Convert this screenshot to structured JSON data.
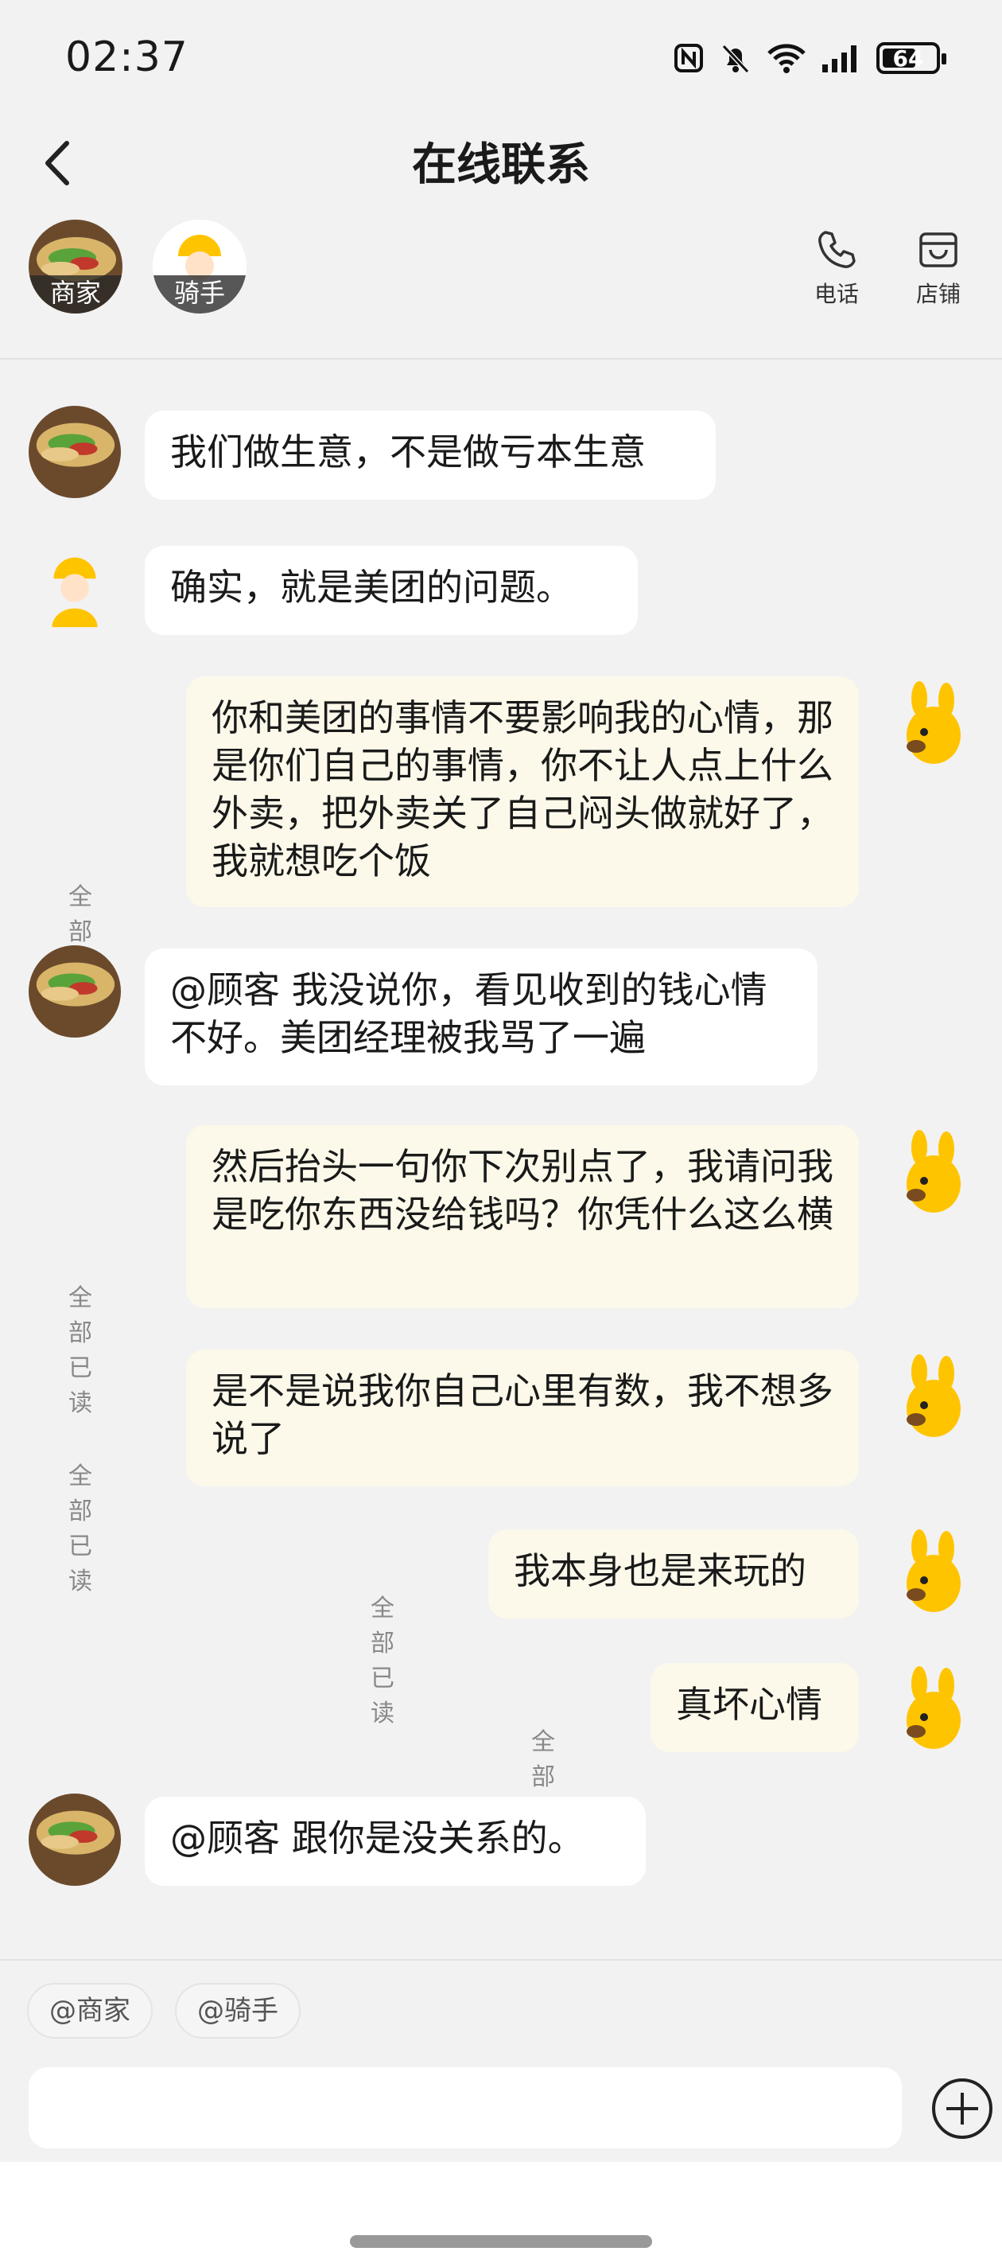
{
  "status_bar": {
    "time": "02:37",
    "battery": "64",
    "battery_level": 0.64,
    "icons": [
      "nfc-icon",
      "mute-bell-icon",
      "wifi-icon",
      "signal-icon",
      "battery-icon"
    ]
  },
  "header": {
    "title": "在线联系",
    "back_icon": "chevron-left-icon"
  },
  "contacts": [
    {
      "label": "商家",
      "avatar": "food-photo"
    },
    {
      "label": "骑手",
      "avatar": "rider-helmet"
    }
  ],
  "header_actions": [
    {
      "label": "电话",
      "icon": "phone-icon"
    },
    {
      "label": "店铺",
      "icon": "store-icon"
    }
  ],
  "messages": [
    {
      "side": "left",
      "sender": "merchant",
      "text": "我们做生意，不是做亏本生意"
    },
    {
      "side": "left",
      "sender": "rider",
      "text": "确实，就是美团的问题。"
    },
    {
      "side": "right",
      "sender": "me",
      "text": "你和美团的事情不要影响我的心情，那是你们自己的事情，你不让人点上什么外卖，把外卖关了自己闷头做就好了，我就想吃个饭",
      "read": "全部已读"
    },
    {
      "side": "left",
      "sender": "merchant",
      "text": "@顾客 我没说你，看见收到的钱心情不好。美团经理被我骂了一遍"
    },
    {
      "side": "right",
      "sender": "me",
      "text": "然后抬头一句你下次别点了，我请问我是吃你东西没给钱吗？你凭什么这么横",
      "read": "全部已读"
    },
    {
      "side": "right",
      "sender": "me",
      "text": "是不是说我你自己心里有数，我不想多说了",
      "read": "全部已读"
    },
    {
      "side": "right",
      "sender": "me",
      "text": "我本身也是来玩的",
      "read": "全部已读"
    },
    {
      "side": "right",
      "sender": "me",
      "text": "真坏心情",
      "read": "全部已读"
    },
    {
      "side": "left",
      "sender": "merchant",
      "text": "@顾客 跟你是没关系的。"
    }
  ],
  "bottom": {
    "mention_chips": [
      "@商家",
      "@骑手"
    ],
    "input_value": "",
    "plus_icon": "plus-circle-icon"
  },
  "colors": {
    "background": "#f2f2f2",
    "left_bubble": "#ffffff",
    "right_bubble": "#fcf9ea",
    "brand_yellow": "#ffc400"
  }
}
